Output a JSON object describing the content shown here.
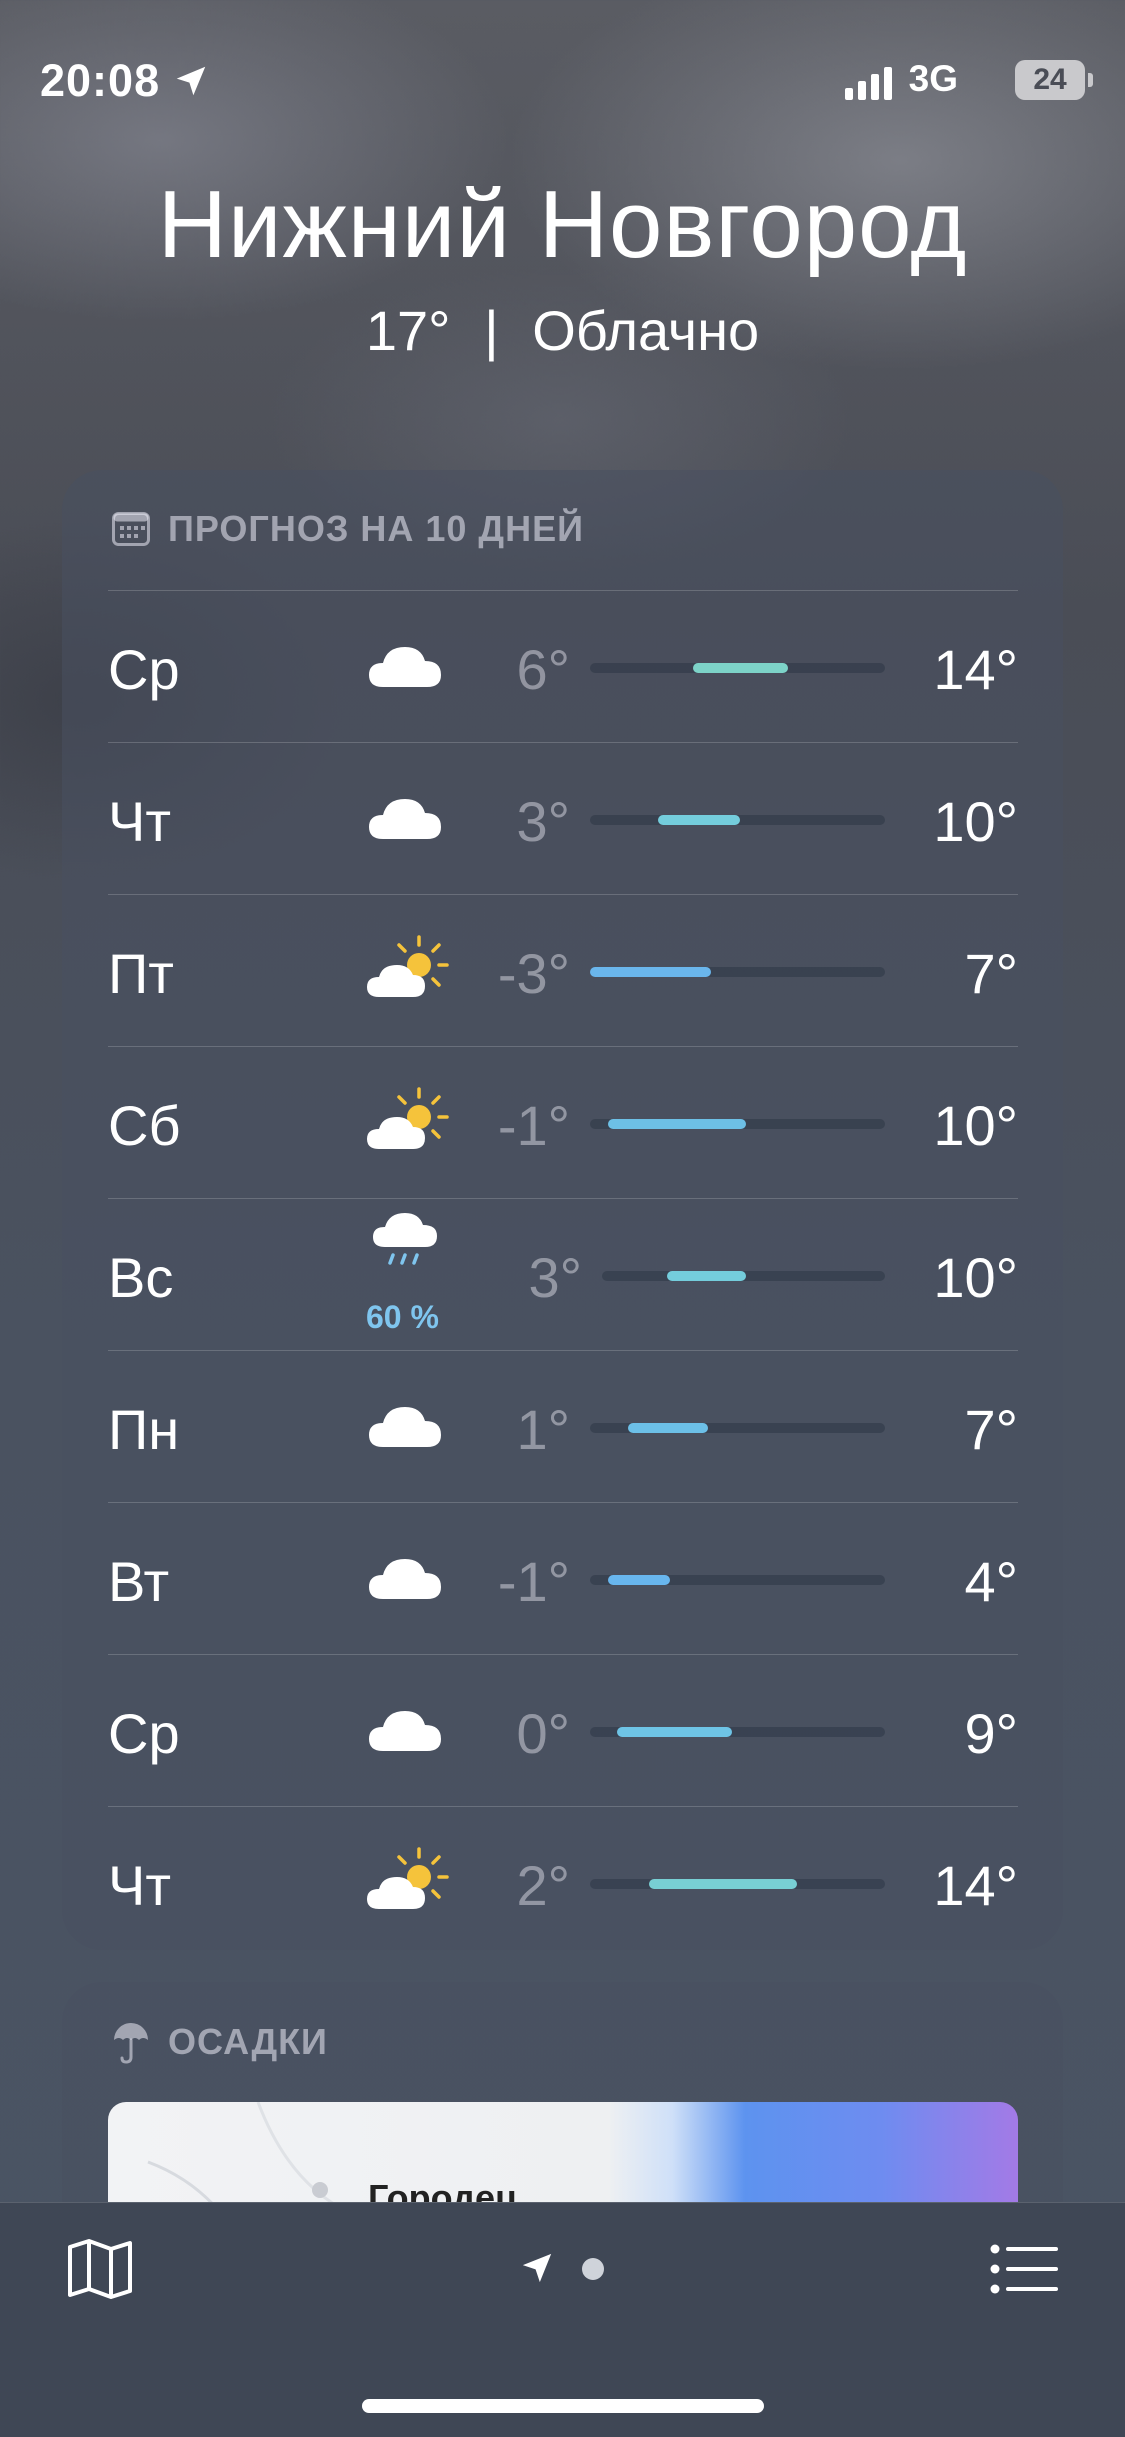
{
  "status_bar": {
    "time": "20:08",
    "network": "3G",
    "battery": "24"
  },
  "header": {
    "city": "Нижний Новгород",
    "temperature": "17°",
    "separator": "|",
    "condition": "Облачно"
  },
  "forecast": {
    "title": "ПРОГНОЗ НА 10 ДНЕЙ",
    "icon": "calendar-icon",
    "days": [
      {
        "day": "Ср",
        "icon": "cloud-icon",
        "low": "6°",
        "high": "14°",
        "range": [
          0.35,
          0.67
        ],
        "color": "#7dd3c8"
      },
      {
        "day": "Чт",
        "icon": "cloud-icon",
        "low": "3°",
        "high": "10°",
        "range": [
          0.23,
          0.51
        ],
        "color": "#74cddc"
      },
      {
        "day": "Пт",
        "icon": "partly-sunny-icon",
        "low": "-3°",
        "high": "7°",
        "range": [
          0.0,
          0.41
        ],
        "color": "#6ab6ec"
      },
      {
        "day": "Сб",
        "icon": "partly-sunny-icon",
        "low": "-1°",
        "high": "10°",
        "range": [
          0.06,
          0.53
        ],
        "color": "#6dc0e6"
      },
      {
        "day": "Вс",
        "icon": "rain-icon",
        "precip": "60 %",
        "low": "3°",
        "high": "10°",
        "range": [
          0.23,
          0.51
        ],
        "color": "#74cddc"
      },
      {
        "day": "Пн",
        "icon": "cloud-icon",
        "low": "1°",
        "high": "7°",
        "range": [
          0.13,
          0.4
        ],
        "color": "#6cc0e8"
      },
      {
        "day": "Вт",
        "icon": "cloud-icon",
        "low": "-1°",
        "high": "4°",
        "range": [
          0.06,
          0.27
        ],
        "color": "#68b6ee"
      },
      {
        "day": "Ср",
        "icon": "cloud-icon",
        "low": "0°",
        "high": "9°",
        "range": [
          0.09,
          0.48
        ],
        "color": "#6ec4e6"
      },
      {
        "day": "Чт",
        "icon": "partly-sunny-icon",
        "low": "2°",
        "high": "14°",
        "range": [
          0.2,
          0.7
        ],
        "color": "#78cfd4"
      }
    ]
  },
  "precipitation": {
    "title": "ОСАДКИ",
    "icon": "umbrella-icon",
    "map_label": "Городец"
  },
  "tab_bar": {
    "left_icon": "map-icon",
    "center_icon": "location-arrow-icon",
    "right_icon": "list-icon"
  }
}
